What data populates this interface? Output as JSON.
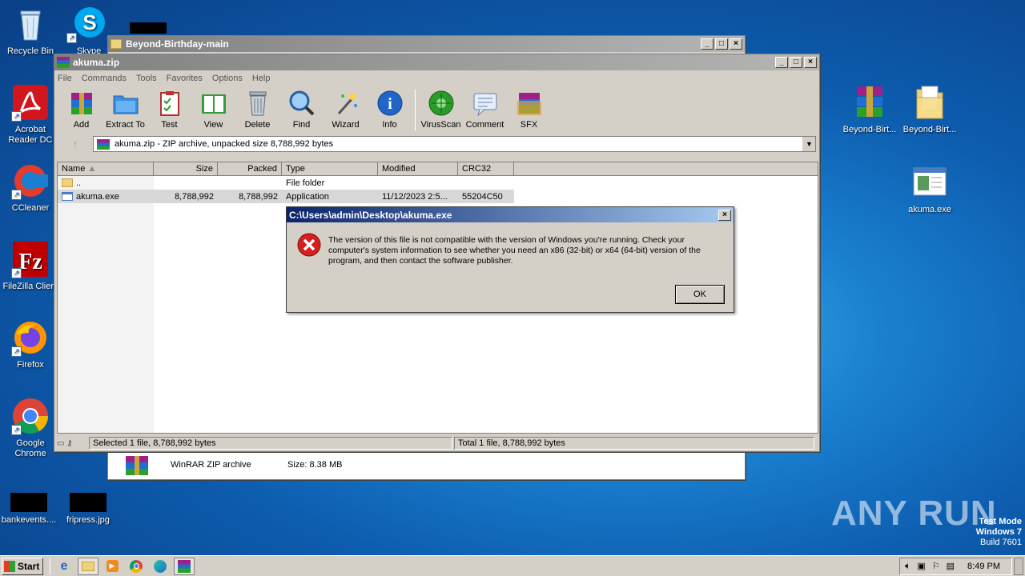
{
  "desktop": {
    "icons_left": [
      {
        "label": "Recycle Bin"
      },
      {
        "label": "Skype"
      },
      {
        "label": "Acrobat Reader DC"
      },
      {
        "label": "CCleaner"
      },
      {
        "label": "FileZilla Client"
      },
      {
        "label": "Firefox"
      },
      {
        "label": "Google Chrome"
      },
      {
        "label": "bankevents...."
      },
      {
        "label": "fripress.jpg"
      }
    ],
    "icons_right": [
      {
        "label": "Beyond-Birt..."
      },
      {
        "label": "Beyond-Birt..."
      },
      {
        "label": "akuma.exe"
      }
    ],
    "watermark": {
      "text": "ANY RUN"
    },
    "test_mode": {
      "line1": "Test Mode",
      "line2": "Windows 7",
      "line3": "Build 7601"
    }
  },
  "back_window": {
    "title": "Beyond-Birthday-main",
    "file_type": "WinRAR ZIP archive",
    "file_size": "Size: 8.38 MB"
  },
  "winrar": {
    "title": "akuma.zip",
    "menu": [
      "File",
      "Commands",
      "Tools",
      "Favorites",
      "Options",
      "Help"
    ],
    "toolbar": [
      {
        "label": "Add",
        "icon": "add-archive-icon"
      },
      {
        "label": "Extract To",
        "icon": "extract-folder-icon"
      },
      {
        "label": "Test",
        "icon": "test-clipboard-icon"
      },
      {
        "label": "View",
        "icon": "view-book-icon"
      },
      {
        "label": "Delete",
        "icon": "trash-icon"
      },
      {
        "label": "Find",
        "icon": "magnifier-icon"
      },
      {
        "label": "Wizard",
        "icon": "wand-icon"
      },
      {
        "label": "Info",
        "icon": "info-icon"
      },
      {
        "label": "VirusScan",
        "icon": "virus-scan-icon"
      },
      {
        "label": "Comment",
        "icon": "comment-icon"
      },
      {
        "label": "SFX",
        "icon": "sfx-box-icon"
      }
    ],
    "address": "akuma.zip - ZIP archive, unpacked size 8,788,992 bytes",
    "columns": [
      "Name",
      "Size",
      "Packed",
      "Type",
      "Modified",
      "CRC32"
    ],
    "rows": [
      {
        "name": "..",
        "size": "",
        "packed": "",
        "type": "File folder",
        "modified": "",
        "crc": ""
      },
      {
        "name": "akuma.exe",
        "size": "8,788,992",
        "packed": "8,788,992",
        "type": "Application",
        "modified": "11/12/2023 2:5...",
        "crc": "55204C50"
      }
    ],
    "status_left": "Selected 1 file, 8,788,992 bytes",
    "status_right": "Total 1 file, 8,788,992 bytes"
  },
  "dialog": {
    "title": "C:\\Users\\admin\\Desktop\\akuma.exe",
    "message": "The version of this file is not compatible with the version of Windows you're running. Check your computer's system information to see whether you need an x86 (32-bit) or x64 (64-bit) version of the program, and then contact the software publisher.",
    "ok_label": "OK"
  },
  "taskbar": {
    "start_label": "Start",
    "clock": "8:49 PM"
  }
}
